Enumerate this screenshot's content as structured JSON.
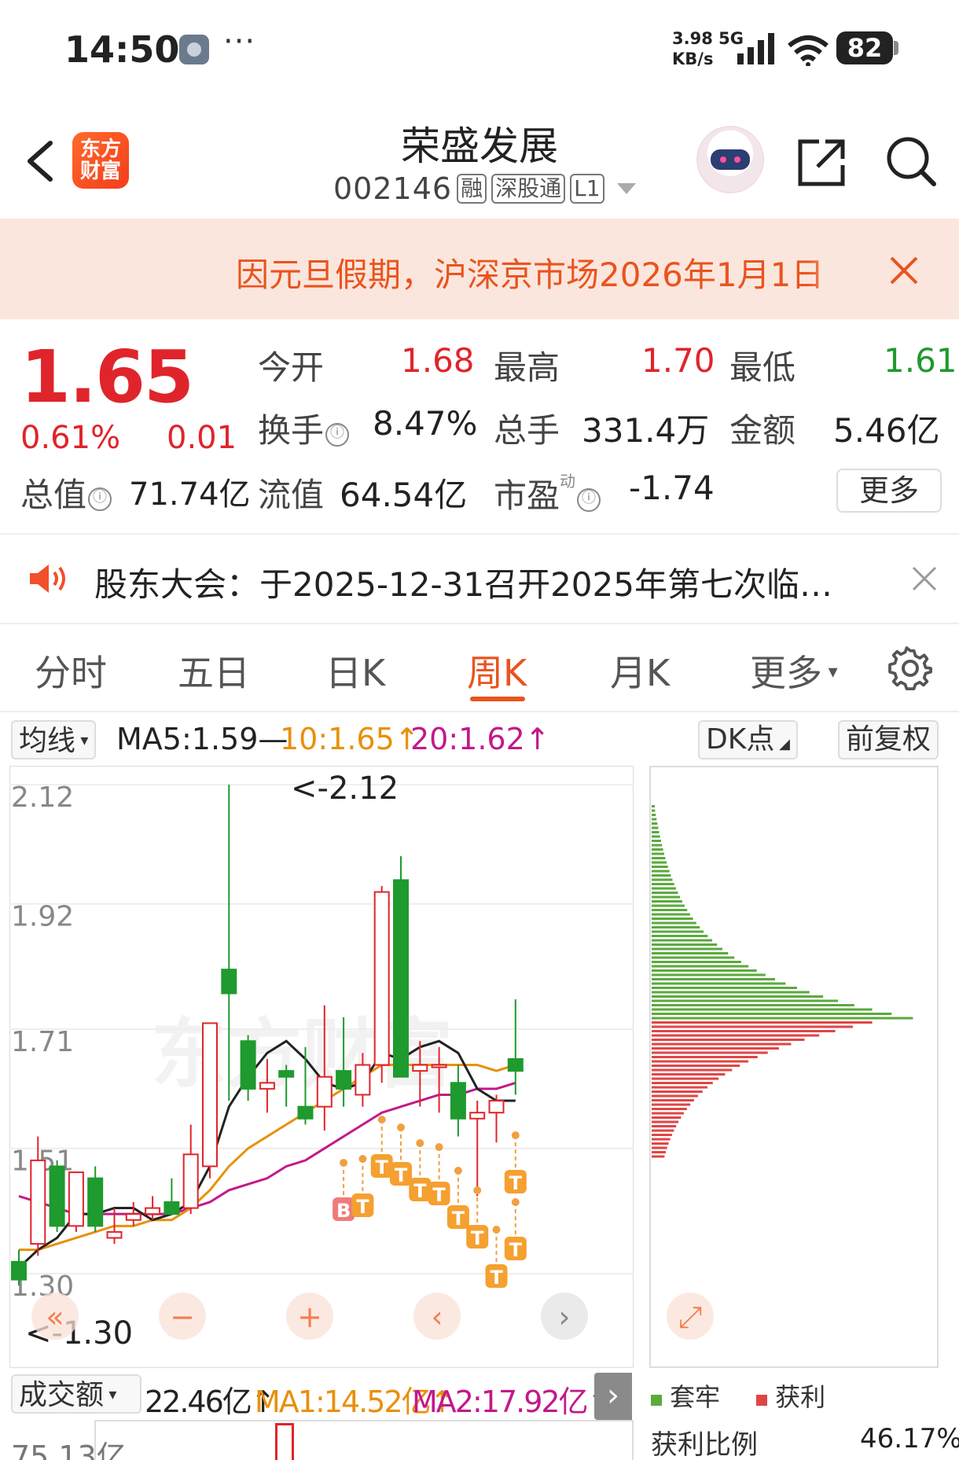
{
  "status_bar": {
    "time": "14:50",
    "dots": "···",
    "net_speed_line1": "3.98",
    "net_speed_unit": "KB/s",
    "network": "5G",
    "battery": "82"
  },
  "header": {
    "logo_line1": "东方",
    "logo_line2": "财富",
    "stock_name": "荣盛发展",
    "stock_code": "002146",
    "tags": [
      "融",
      "深股通",
      "L1"
    ]
  },
  "notice": {
    "text": "因元旦假期，沪深京市场2026年1月1日",
    "close_icon": "close-icon"
  },
  "quote": {
    "price": "1.65",
    "pct": "0.61%",
    "change": "0.01",
    "open_label": "今开",
    "open_value": "1.68",
    "high_label": "最高",
    "high_value": "1.70",
    "low_label": "最低",
    "low_value": "1.61",
    "turnover_label": "换手",
    "turnover_value": "8.47%",
    "volume_label": "总手",
    "volume_value": "331.4万",
    "amount_label": "金额",
    "amount_value": "5.46亿",
    "mktcap_label": "总值",
    "mktcap_value": "71.74亿",
    "float_label": "流值",
    "float_value": "64.54亿",
    "pe_label": "市盈",
    "pe_sup": "动",
    "pe_value": "-1.74",
    "more_label": "更多",
    "info_icon": "ⓘ"
  },
  "announcement": {
    "text": "股东大会：于2025-12-31召开2025年第七次临时…"
  },
  "period_tabs": {
    "items": [
      "分时",
      "五日",
      "日K",
      "周K",
      "月K",
      "更多"
    ],
    "active": "周K"
  },
  "ma_row": {
    "indicator_label": "均线",
    "ma5": "MA5:1.59—",
    "ma10": "10:1.65↑",
    "ma20": "20:1.62↑",
    "dk_label": "DK点",
    "adjust_label": "前复权",
    "colors": {
      "ma5": "#222222",
      "ma10": "#e8900c",
      "ma20": "#c2198a"
    }
  },
  "kchart": {
    "y_ticks": [
      "2.12",
      "1.92",
      "1.71",
      "1.51",
      "1.30"
    ],
    "high_annotation": "<-2.12",
    "low_annotation": "<-1.30",
    "watermark": "东方财富",
    "buy_marker": "B",
    "t_marker": "T",
    "controls": [
      "«",
      "−",
      "+",
      "‹",
      "›",
      "⤢"
    ]
  },
  "chips_legend": {
    "trapped_label": "套牢",
    "profit_label": "获利",
    "profit_ratio_label": "获利比例",
    "profit_ratio_value": "46.17%",
    "colors": {
      "trapped": "#5aaa3c",
      "profit": "#e04545"
    }
  },
  "volume_row": {
    "indicator_label": "成交额",
    "value": "22.46亿↑",
    "ma1": "MA1:14.52亿↑",
    "ma2": "MA2:17.92亿↑",
    "axis_top": "75.13亿",
    "expand_arrow": "›"
  },
  "chart_data": {
    "type": "candlestick",
    "ylim": [
      1.3,
      2.12
    ],
    "candles": [
      {
        "o": 1.32,
        "h": 1.34,
        "l": 1.28,
        "c": 1.29
      },
      {
        "o": 1.35,
        "h": 1.53,
        "l": 1.33,
        "c": 1.49
      },
      {
        "o": 1.48,
        "h": 1.49,
        "l": 1.37,
        "c": 1.38
      },
      {
        "o": 1.38,
        "h": 1.47,
        "l": 1.37,
        "c": 1.47
      },
      {
        "o": 1.46,
        "h": 1.48,
        "l": 1.37,
        "c": 1.38
      },
      {
        "o": 1.36,
        "h": 1.41,
        "l": 1.35,
        "c": 1.37
      },
      {
        "o": 1.39,
        "h": 1.42,
        "l": 1.38,
        "c": 1.4
      },
      {
        "o": 1.4,
        "h": 1.43,
        "l": 1.39,
        "c": 1.41
      },
      {
        "o": 1.42,
        "h": 1.46,
        "l": 1.4,
        "c": 1.4
      },
      {
        "o": 1.41,
        "h": 1.55,
        "l": 1.4,
        "c": 1.5
      },
      {
        "o": 1.48,
        "h": 1.72,
        "l": 1.46,
        "c": 1.72
      },
      {
        "o": 1.81,
        "h": 2.12,
        "l": 1.59,
        "c": 1.77
      },
      {
        "o": 1.69,
        "h": 1.7,
        "l": 1.59,
        "c": 1.61
      },
      {
        "o": 1.61,
        "h": 1.66,
        "l": 1.57,
        "c": 1.62
      },
      {
        "o": 1.64,
        "h": 1.65,
        "l": 1.58,
        "c": 1.63
      },
      {
        "o": 1.58,
        "h": 1.68,
        "l": 1.55,
        "c": 1.56
      },
      {
        "o": 1.58,
        "h": 1.75,
        "l": 1.54,
        "c": 1.63
      },
      {
        "o": 1.64,
        "h": 1.73,
        "l": 1.58,
        "c": 1.61
      },
      {
        "o": 1.6,
        "h": 1.67,
        "l": 1.58,
        "c": 1.65
      },
      {
        "o": 1.65,
        "h": 1.95,
        "l": 1.62,
        "c": 1.94
      },
      {
        "o": 1.96,
        "h": 2.0,
        "l": 1.63,
        "c": 1.63
      },
      {
        "o": 1.64,
        "h": 1.69,
        "l": 1.58,
        "c": 1.65
      },
      {
        "o": 1.65,
        "h": 1.68,
        "l": 1.57,
        "c": 1.65
      },
      {
        "o": 1.62,
        "h": 1.65,
        "l": 1.53,
        "c": 1.56
      },
      {
        "o": 1.56,
        "h": 1.59,
        "l": 1.43,
        "c": 1.57
      },
      {
        "o": 1.57,
        "h": 1.6,
        "l": 1.52,
        "c": 1.59
      },
      {
        "o": 1.66,
        "h": 1.76,
        "l": 1.6,
        "c": 1.64
      }
    ],
    "ma5": [
      1.31,
      1.34,
      1.36,
      1.4,
      1.4,
      1.41,
      1.41,
      1.39,
      1.4,
      1.42,
      1.48,
      1.58,
      1.63,
      1.67,
      1.69,
      1.66,
      1.62,
      1.61,
      1.62,
      1.67,
      1.66,
      1.68,
      1.69,
      1.67,
      1.61,
      1.59,
      1.59
    ],
    "ma10": [
      1.34,
      1.34,
      1.35,
      1.36,
      1.37,
      1.38,
      1.38,
      1.39,
      1.39,
      1.41,
      1.44,
      1.48,
      1.51,
      1.53,
      1.55,
      1.57,
      1.59,
      1.61,
      1.63,
      1.65,
      1.65,
      1.65,
      1.65,
      1.65,
      1.65,
      1.64,
      1.65
    ],
    "ma20": [
      1.43,
      1.42,
      1.41,
      1.4,
      1.4,
      1.4,
      1.4,
      1.4,
      1.4,
      1.41,
      1.42,
      1.44,
      1.45,
      1.46,
      1.48,
      1.49,
      1.51,
      1.53,
      1.55,
      1.57,
      1.58,
      1.59,
      1.6,
      1.6,
      1.61,
      1.61,
      1.62
    ]
  }
}
